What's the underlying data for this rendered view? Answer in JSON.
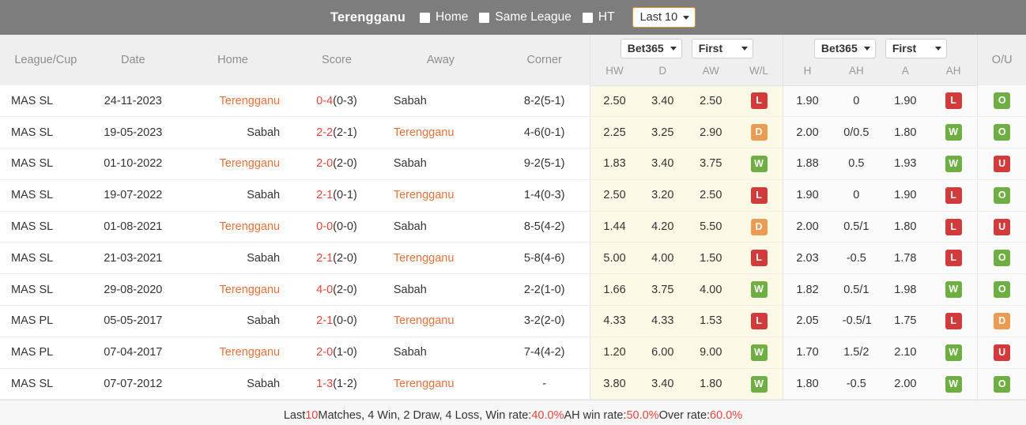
{
  "topbar": {
    "title": "Terengganu",
    "filters": [
      {
        "label": "Home",
        "checked": false
      },
      {
        "label": "Same League",
        "checked": false
      },
      {
        "label": "HT",
        "checked": false
      }
    ],
    "range_select": {
      "value": "Last 10",
      "icon": "chevron-down-icon"
    }
  },
  "table": {
    "headers": {
      "league": "League/Cup",
      "date": "Date",
      "home": "Home",
      "score": "Score",
      "away": "Away",
      "corner": "Corner",
      "ou": "O/U"
    },
    "odds_group": {
      "bookmaker_select": "Bet365",
      "period_select": "First",
      "cols": [
        "HW",
        "D",
        "AW",
        "W/L"
      ]
    },
    "ah_group": {
      "bookmaker_select": "Bet365",
      "period_select": "First",
      "cols": [
        "H",
        "AH",
        "A",
        "AH"
      ]
    },
    "rows": [
      {
        "league": "MAS SL",
        "date": "24-11-2023",
        "home": "Terengganu",
        "home_hl": true,
        "score": "0-4",
        "score_ht": "(0-3)",
        "away": "Sabah",
        "away_hl": false,
        "corner": "8-2(5-1)",
        "hw": "2.50",
        "d": "3.40",
        "aw": "2.50",
        "wl": "L",
        "h": "1.90",
        "ah1": "0",
        "a": "1.90",
        "ah2": "L",
        "ou": "O"
      },
      {
        "league": "MAS SL",
        "date": "19-05-2023",
        "home": "Sabah",
        "home_hl": false,
        "score": "2-2",
        "score_ht": "(2-1)",
        "away": "Terengganu",
        "away_hl": true,
        "corner": "4-6(0-1)",
        "hw": "2.25",
        "d": "3.25",
        "aw": "2.90",
        "wl": "D",
        "h": "2.00",
        "ah1": "0/0.5",
        "a": "1.80",
        "ah2": "W",
        "ou": "O"
      },
      {
        "league": "MAS SL",
        "date": "01-10-2022",
        "home": "Terengganu",
        "home_hl": true,
        "score": "2-0",
        "score_ht": "(2-0)",
        "away": "Sabah",
        "away_hl": false,
        "corner": "9-2(5-1)",
        "hw": "1.83",
        "d": "3.40",
        "aw": "3.75",
        "wl": "W",
        "h": "1.88",
        "ah1": "0.5",
        "a": "1.93",
        "ah2": "W",
        "ou": "U"
      },
      {
        "league": "MAS SL",
        "date": "19-07-2022",
        "home": "Sabah",
        "home_hl": false,
        "score": "2-1",
        "score_ht": "(0-1)",
        "away": "Terengganu",
        "away_hl": true,
        "corner": "1-4(0-3)",
        "hw": "2.50",
        "d": "3.20",
        "aw": "2.50",
        "wl": "L",
        "h": "1.90",
        "ah1": "0",
        "a": "1.90",
        "ah2": "L",
        "ou": "O"
      },
      {
        "league": "MAS SL",
        "date": "01-08-2021",
        "home": "Terengganu",
        "home_hl": true,
        "score": "0-0",
        "score_ht": "(0-0)",
        "away": "Sabah",
        "away_hl": false,
        "corner": "8-5(4-2)",
        "hw": "1.44",
        "d": "4.20",
        "aw": "5.50",
        "wl": "D",
        "h": "2.00",
        "ah1": "0.5/1",
        "a": "1.80",
        "ah2": "L",
        "ou": "U"
      },
      {
        "league": "MAS SL",
        "date": "21-03-2021",
        "home": "Sabah",
        "home_hl": false,
        "score": "2-1",
        "score_ht": "(2-0)",
        "away": "Terengganu",
        "away_hl": true,
        "corner": "5-8(4-6)",
        "hw": "5.00",
        "d": "4.00",
        "aw": "1.50",
        "wl": "L",
        "h": "2.03",
        "ah1": "-0.5",
        "a": "1.78",
        "ah2": "L",
        "ou": "O"
      },
      {
        "league": "MAS SL",
        "date": "29-08-2020",
        "home": "Terengganu",
        "home_hl": true,
        "score": "4-0",
        "score_ht": "(2-0)",
        "away": "Sabah",
        "away_hl": false,
        "corner": "2-2(1-0)",
        "hw": "1.66",
        "d": "3.75",
        "aw": "4.00",
        "wl": "W",
        "h": "1.82",
        "ah1": "0.5/1",
        "a": "1.98",
        "ah2": "W",
        "ou": "O"
      },
      {
        "league": "MAS PL",
        "date": "05-05-2017",
        "home": "Sabah",
        "home_hl": false,
        "score": "2-1",
        "score_ht": "(0-0)",
        "away": "Terengganu",
        "away_hl": true,
        "corner": "3-2(2-0)",
        "hw": "4.33",
        "d": "4.33",
        "aw": "1.53",
        "wl": "L",
        "h": "2.05",
        "ah1": "-0.5/1",
        "a": "1.75",
        "ah2": "L",
        "ou": "D"
      },
      {
        "league": "MAS PL",
        "date": "07-04-2017",
        "home": "Terengganu",
        "home_hl": true,
        "score": "2-0",
        "score_ht": "(1-0)",
        "away": "Sabah",
        "away_hl": false,
        "corner": "7-4(4-2)",
        "hw": "1.20",
        "d": "6.00",
        "aw": "9.00",
        "wl": "W",
        "h": "1.70",
        "ah1": "1.5/2",
        "a": "2.10",
        "ah2": "W",
        "ou": "U"
      },
      {
        "league": "MAS SL",
        "date": "07-07-2012",
        "home": "Sabah",
        "home_hl": false,
        "score": "1-3",
        "score_ht": "(1-2)",
        "away": "Terengganu",
        "away_hl": true,
        "corner": "-",
        "hw": "3.80",
        "d": "3.40",
        "aw": "1.80",
        "wl": "W",
        "h": "1.80",
        "ah1": "-0.5",
        "a": "2.00",
        "ah2": "W",
        "ou": "O"
      }
    ]
  },
  "footer": {
    "p1": "Last ",
    "count": "10",
    "p2": " Matches, 4 Win, 2 Draw, 4 Loss, Win rate: ",
    "win_rate": "40.0%",
    "p3": " AH win rate: ",
    "ah_win_rate": "50.0%",
    "p4": " Over rate: ",
    "over_rate": "60.0%"
  }
}
